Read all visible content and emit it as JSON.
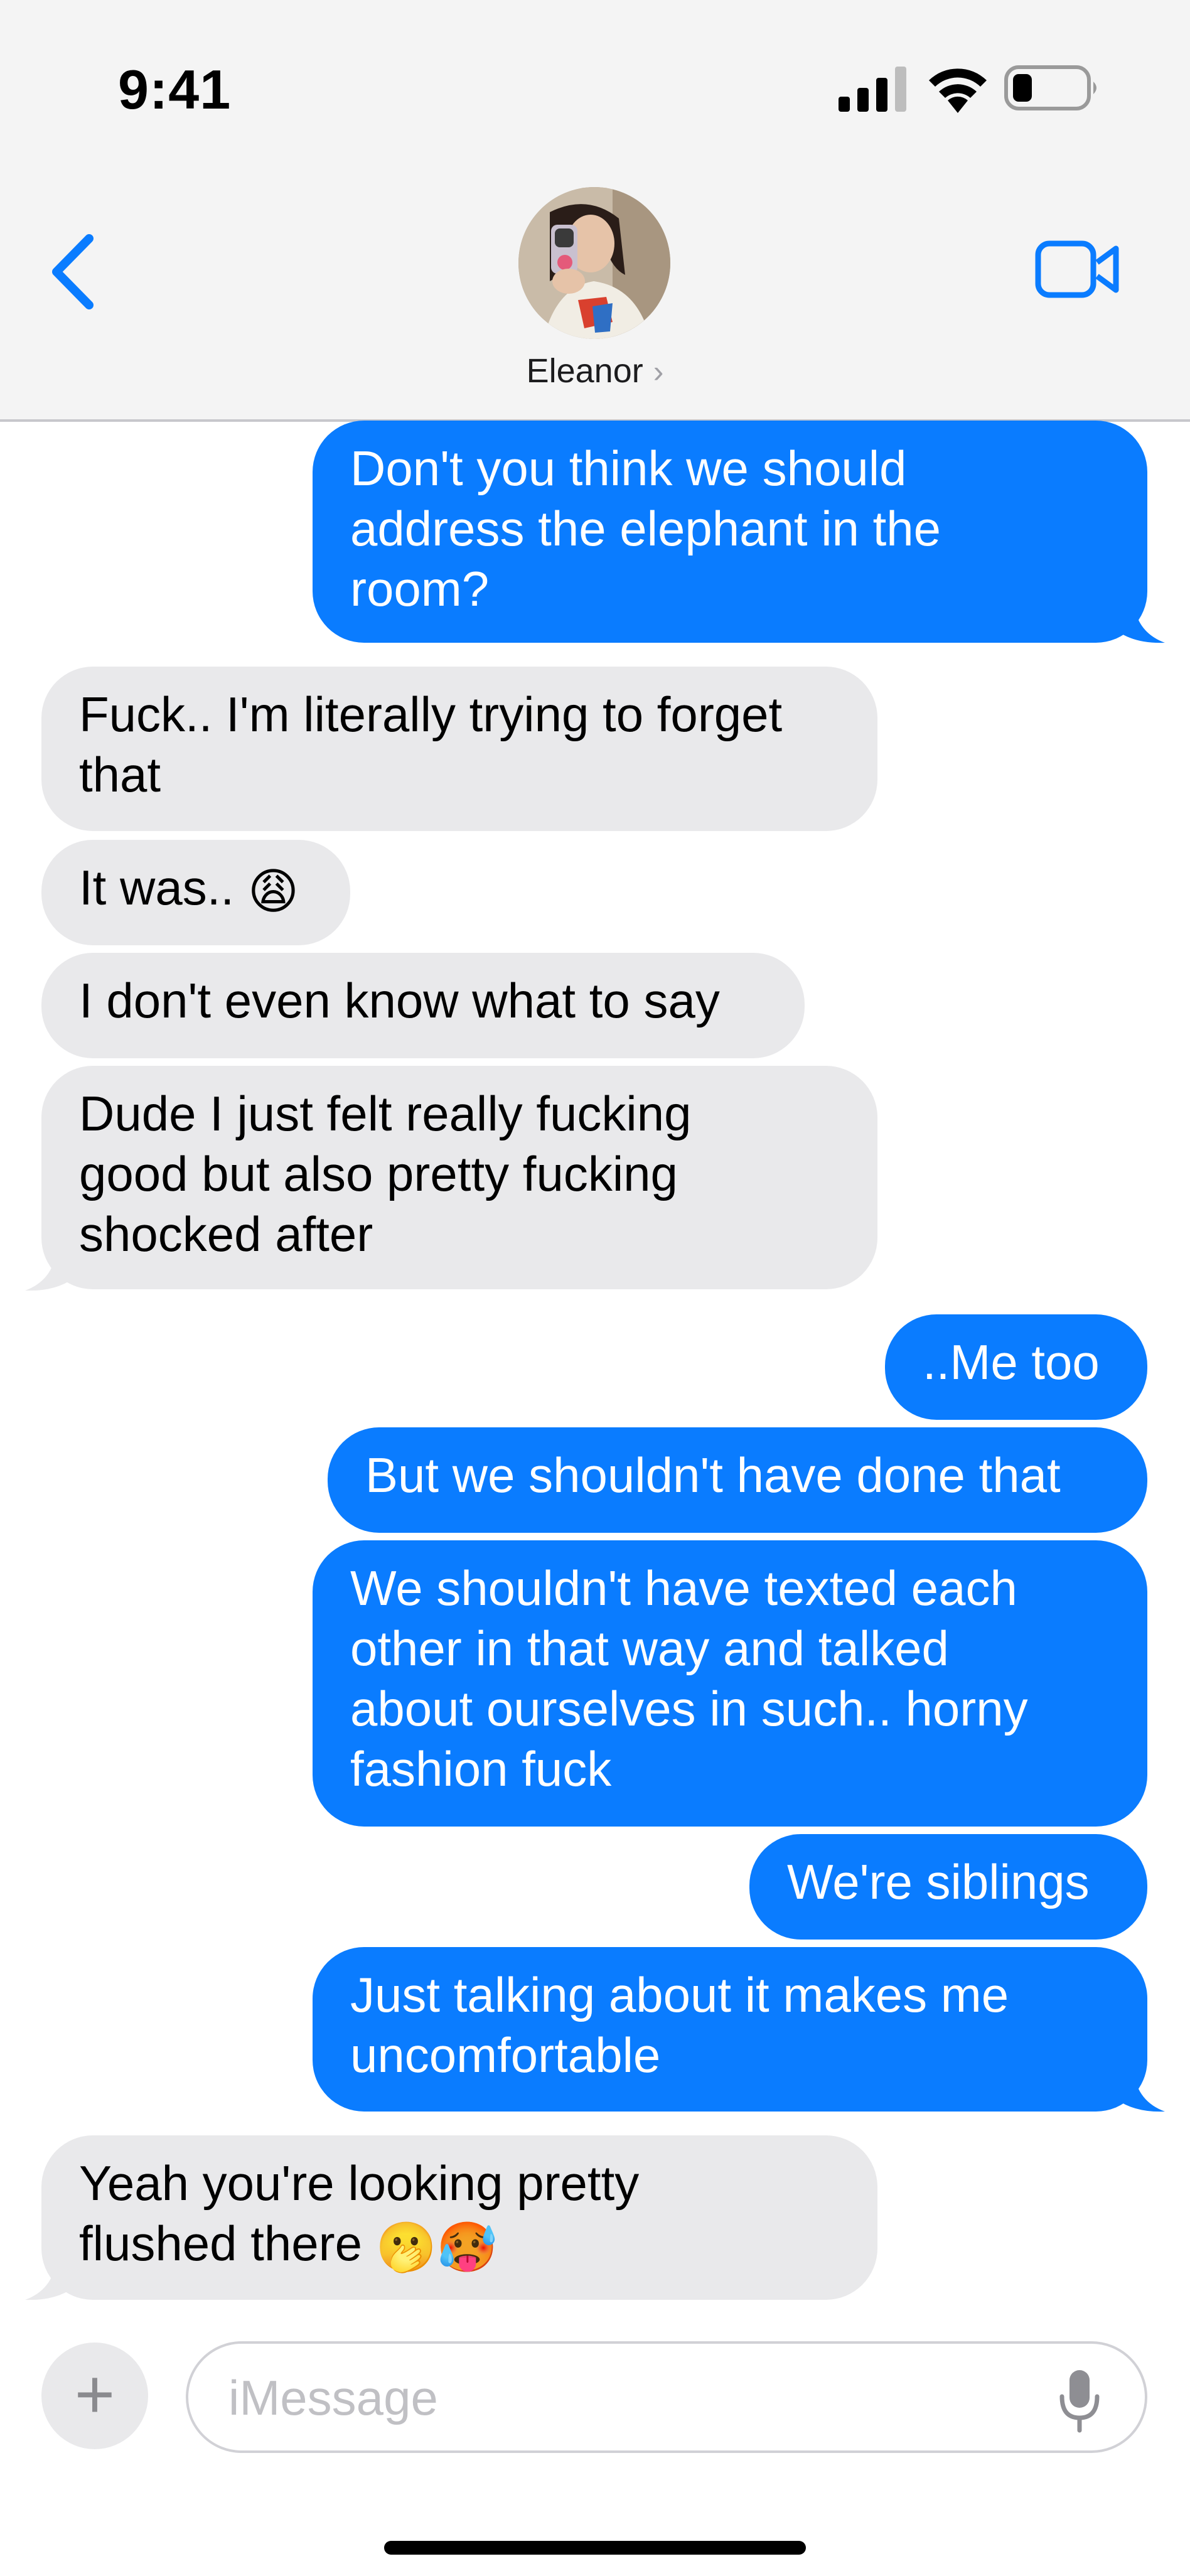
{
  "status_bar": {
    "time": "9:41",
    "signal_icon": "cellular-signal-icon",
    "wifi_icon": "wifi-icon",
    "battery_icon": "battery-low-icon"
  },
  "header": {
    "back_icon": "chevron-left-icon",
    "contact_name": "Eleanor",
    "contact_chevron": "›",
    "video_icon": "video-camera-icon",
    "accent_color": "#0a7cff"
  },
  "messages": [
    {
      "from": "me",
      "lines": [
        "Don't you think we should",
        "address the elephant in the",
        "room?"
      ]
    },
    {
      "from": "them",
      "lines": [
        "Fuck.. I'm literally trying to forget",
        "that"
      ]
    },
    {
      "from": "them",
      "lines": [
        "It was.."
      ],
      "emoji": "😩"
    },
    {
      "from": "them",
      "lines": [
        "I don't even know what to say"
      ]
    },
    {
      "from": "them",
      "lines": [
        "Dude I just felt really fucking",
        "good but also pretty fucking",
        "shocked after"
      ]
    },
    {
      "from": "me",
      "lines": [
        "..Me too"
      ]
    },
    {
      "from": "me",
      "lines": [
        "But we shouldn't have done that"
      ]
    },
    {
      "from": "me",
      "lines": [
        "We shouldn't have texted each",
        "other in that way and talked",
        "about ourselves in such.. horny",
        "fashion fuck"
      ]
    },
    {
      "from": "me",
      "lines": [
        "We're siblings"
      ]
    },
    {
      "from": "me",
      "lines": [
        "Just talking about it makes me",
        "uncomfortable"
      ]
    },
    {
      "from": "them",
      "lines": [
        "Yeah you're looking pretty",
        "flushed there"
      ],
      "emoji": "🫢🥵"
    }
  ],
  "composer": {
    "plus_label": "+",
    "placeholder": "iMessage",
    "mic_icon": "microphone-icon"
  }
}
